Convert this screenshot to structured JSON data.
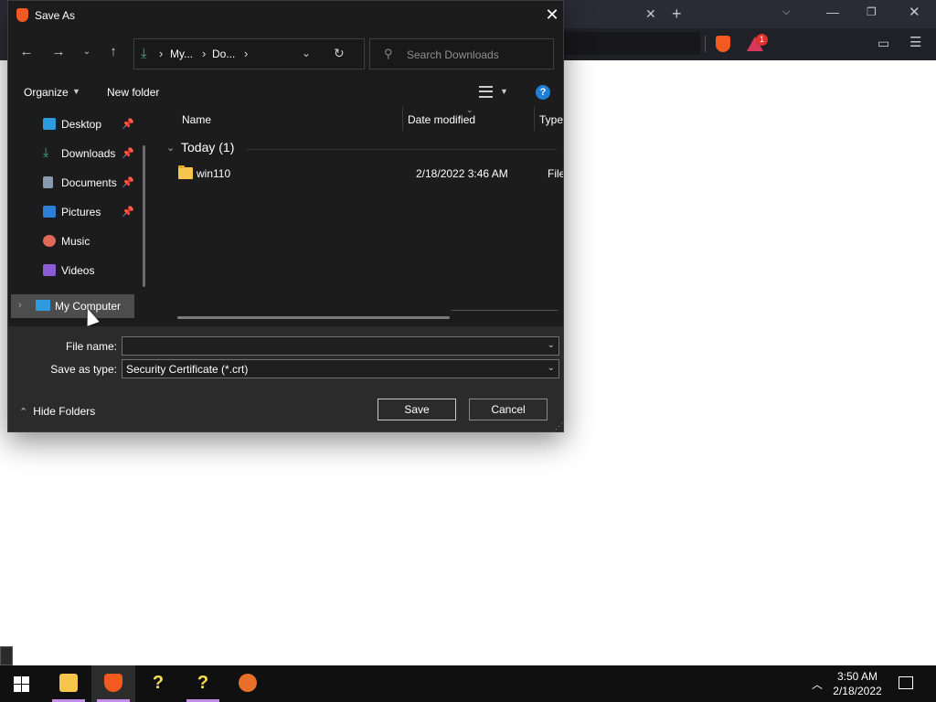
{
  "dialog": {
    "title": "Save As",
    "address": {
      "crumbs": [
        "My...",
        "Do..."
      ]
    },
    "search": {
      "placeholder": "Search Downloads"
    },
    "commands": {
      "organize": "Organize",
      "new_folder": "New folder"
    },
    "nav_items": [
      {
        "label": "Desktop",
        "icon": "desktop-icon",
        "pinned": true,
        "color": "#2e9be0"
      },
      {
        "label": "Downloads",
        "icon": "downloads-icon",
        "pinned": true,
        "color": "#3fb47c"
      },
      {
        "label": "Documents",
        "icon": "documents-icon",
        "pinned": true,
        "color": "#8a9bb0"
      },
      {
        "label": "Pictures",
        "icon": "pictures-icon",
        "pinned": true,
        "color": "#2e7fd6"
      },
      {
        "label": "Music",
        "icon": "music-icon",
        "pinned": false,
        "color": "#e0695a"
      },
      {
        "label": "Videos",
        "icon": "videos-icon",
        "pinned": false,
        "color": "#8b5cd6"
      }
    ],
    "my_computer": "My Computer",
    "columns": {
      "name": "Name",
      "date": "Date modified",
      "type": "Type"
    },
    "group": {
      "label": "Today (1)"
    },
    "files": [
      {
        "name": "win110",
        "date": "2/18/2022 3:46 AM",
        "type": "File folder"
      }
    ],
    "file_name_label": "File name:",
    "file_name_value": "",
    "save_type_label": "Save as type:",
    "save_type_value": "Security Certificate (*.crt)",
    "hide_folders": "Hide Folders",
    "save_button": "Save",
    "cancel_button": "Cancel"
  },
  "status_tip": "",
  "taskbar": {
    "time": "3:50 AM",
    "date": "2/18/2022"
  },
  "colors": {
    "accent": "#0078d7",
    "brave": "#f25a1f",
    "dialog_bg": "#1c1c1c"
  }
}
